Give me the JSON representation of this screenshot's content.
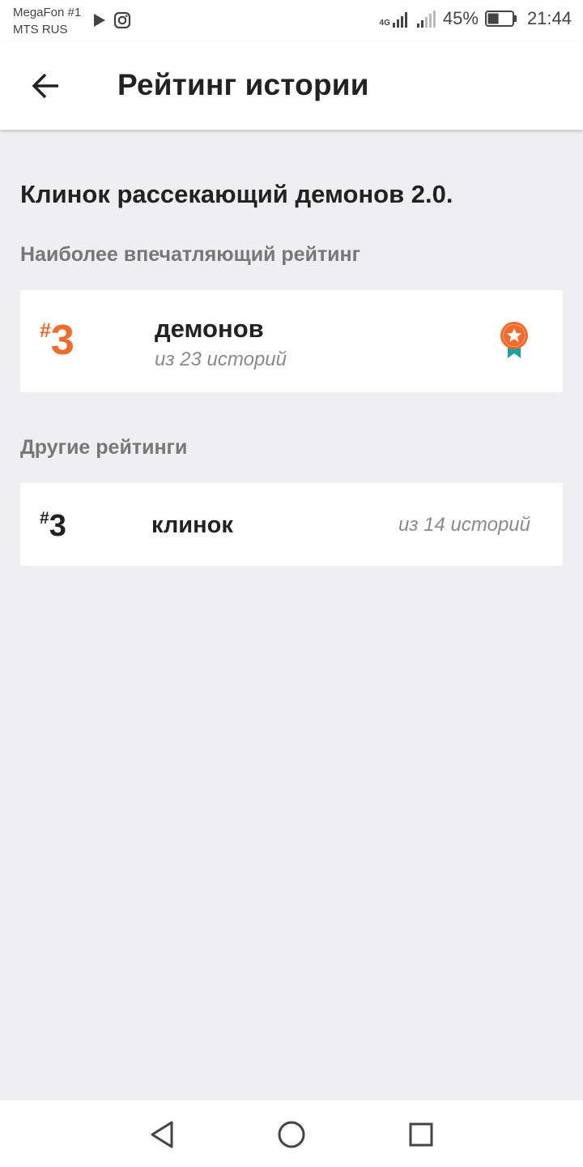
{
  "status_bar": {
    "carrier_1": "MegaFon #1",
    "carrier_2": "MTS RUS",
    "network_label": "4G",
    "battery_percent": "45%",
    "battery_level": 0.45,
    "time": "21:44"
  },
  "app_bar": {
    "title": "Рейтинг истории",
    "back_icon": "arrow-left-icon"
  },
  "story": {
    "title": "Клинок рассекающий демонов 2.0."
  },
  "best_ranking": {
    "section_label": "Наиболее впечатляющий рейтинг",
    "hash": "#",
    "rank": "3",
    "tag": "демонов",
    "count": "из 23 историй",
    "icon": "medal-icon",
    "accent_color": "#f26b2a",
    "ribbon_color": "#1aa3a3"
  },
  "other_rankings": {
    "section_label": "Другие рейтинги",
    "items": [
      {
        "hash": "#",
        "rank": "3",
        "tag": "клинок",
        "count": "из 14 историй"
      }
    ]
  },
  "nav_bar": {
    "back_icon": "triangle-back-icon",
    "home_icon": "circle-home-icon",
    "recent_icon": "square-recent-icon"
  }
}
